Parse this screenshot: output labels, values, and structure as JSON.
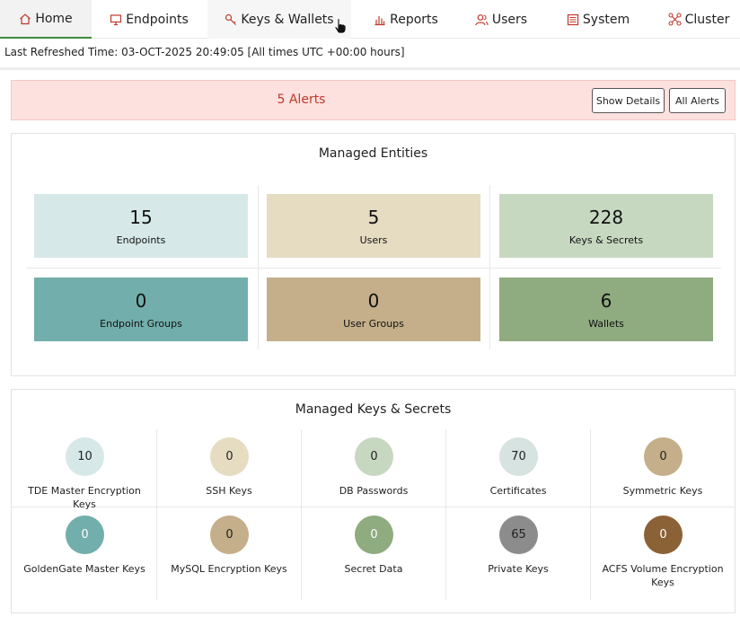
{
  "nav": {
    "tabs": [
      {
        "label": "Home",
        "icon": "home-icon"
      },
      {
        "label": "Endpoints",
        "icon": "monitor-icon"
      },
      {
        "label": "Keys & Wallets",
        "icon": "key-icon"
      },
      {
        "label": "Reports",
        "icon": "bar-chart-icon"
      },
      {
        "label": "Users",
        "icon": "users-icon"
      },
      {
        "label": "System",
        "icon": "system-icon"
      },
      {
        "label": "Cluster",
        "icon": "cluster-icon"
      }
    ],
    "accent_color": "#c0392b",
    "active_underline_color": "#3d8b3d"
  },
  "refresh": {
    "text": "Last Refreshed Time: 03-OCT-2025 20:49:05 [All times UTC +00:00 hours]"
  },
  "alerts": {
    "text": "5 Alerts",
    "show_details_label": "Show Details",
    "all_alerts_label": "All Alerts",
    "bg_color": "#fde1df"
  },
  "entities": {
    "title": "Managed Entities",
    "tiles": [
      {
        "value": "15",
        "label": "Endpoints",
        "color": "#d6e9e8"
      },
      {
        "value": "5",
        "label": "Users",
        "color": "#e6dcc2"
      },
      {
        "value": "228",
        "label": "Keys & Secrets",
        "color": "#c7d8c1"
      },
      {
        "value": "0",
        "label": "Endpoint Groups",
        "color": "#72aeab"
      },
      {
        "value": "0",
        "label": "User Groups",
        "color": "#c4af8a"
      },
      {
        "value": "6",
        "label": "Wallets",
        "color": "#8fab80"
      }
    ]
  },
  "keys": {
    "title": "Managed Keys & Secrets",
    "items": [
      {
        "value": "10",
        "label": "TDE Master Encryption Keys",
        "color": "#d6e9e8",
        "text_color": "#222"
      },
      {
        "value": "0",
        "label": "SSH Keys",
        "color": "#e6dcc2",
        "text_color": "#222"
      },
      {
        "value": "0",
        "label": "DB Passwords",
        "color": "#c7d8c1",
        "text_color": "#222"
      },
      {
        "value": "70",
        "label": "Certificates",
        "color": "#d6e3e1",
        "text_color": "#222"
      },
      {
        "value": "0",
        "label": "Symmetric Keys",
        "color": "#c4af8a",
        "text_color": "#222"
      },
      {
        "value": "0",
        "label": "GoldenGate Master Keys",
        "color": "#72aeab",
        "text_color": "#ffffff"
      },
      {
        "value": "0",
        "label": "MySQL Encryption Keys",
        "color": "#c4af8a",
        "text_color": "#222"
      },
      {
        "value": "0",
        "label": "Secret Data",
        "color": "#8fab80",
        "text_color": "#ffffff"
      },
      {
        "value": "65",
        "label": "Private Keys",
        "color": "#8c8c8c",
        "text_color": "#222"
      },
      {
        "value": "0",
        "label": "ACFS Volume Encryption Keys",
        "color": "#8b6136",
        "text_color": "#ffffff"
      }
    ]
  }
}
